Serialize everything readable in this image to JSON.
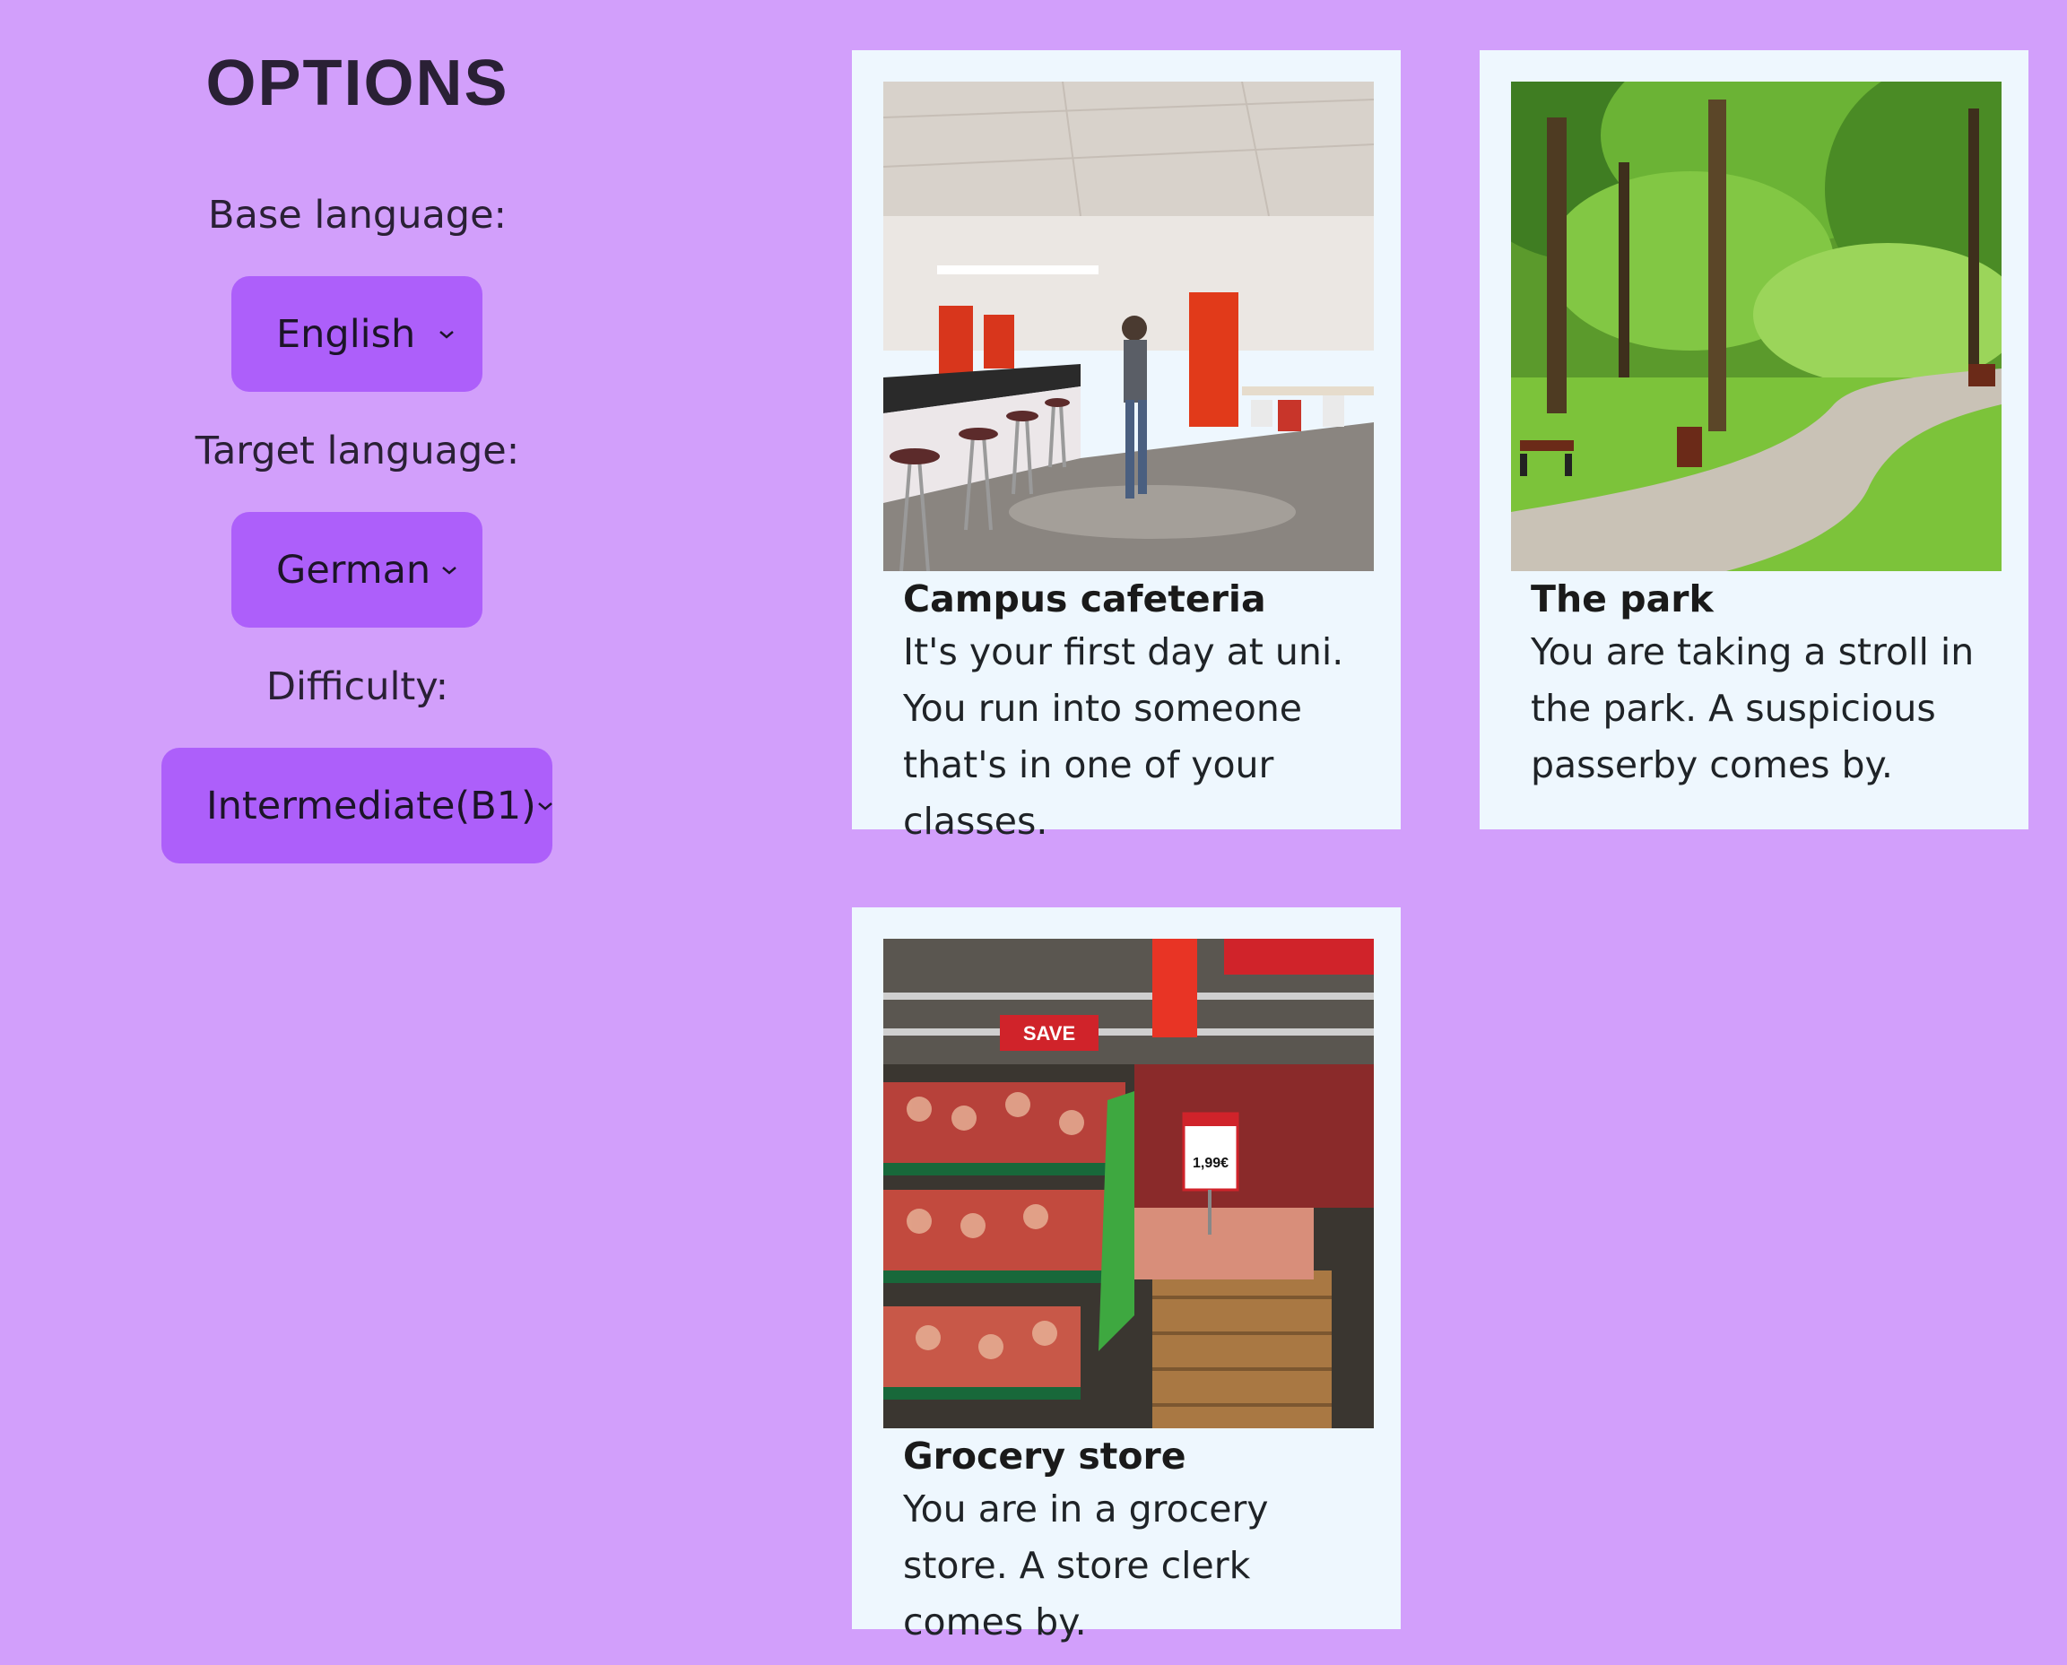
{
  "options": {
    "title": "OPTIONS",
    "base_language_label": "Base language:",
    "base_language_value": "English",
    "target_language_label": "Target language:",
    "target_language_value": "German",
    "difficulty_label": "Difficulty:",
    "difficulty_value": "Intermediate(B1)"
  },
  "scenarios": [
    {
      "title": "Campus cafeteria",
      "description": "It's your first day at uni. You run into someone that's in one of your classes.",
      "image": "cafeteria-photo"
    },
    {
      "title": "The park",
      "description": "You are taking a stroll in the park. A suspicious passerby comes by.",
      "image": "park-photo"
    },
    {
      "title": "Grocery store",
      "description": "You are in a grocery store. A store clerk comes by.",
      "image": "grocery-photo"
    }
  ],
  "grocery_signs": {
    "save": "SAVE",
    "price": "1,99€"
  },
  "colors": {
    "background": "#d29ffb",
    "select_bg": "#ad5ffa",
    "card_bg": "#eef7fe"
  }
}
